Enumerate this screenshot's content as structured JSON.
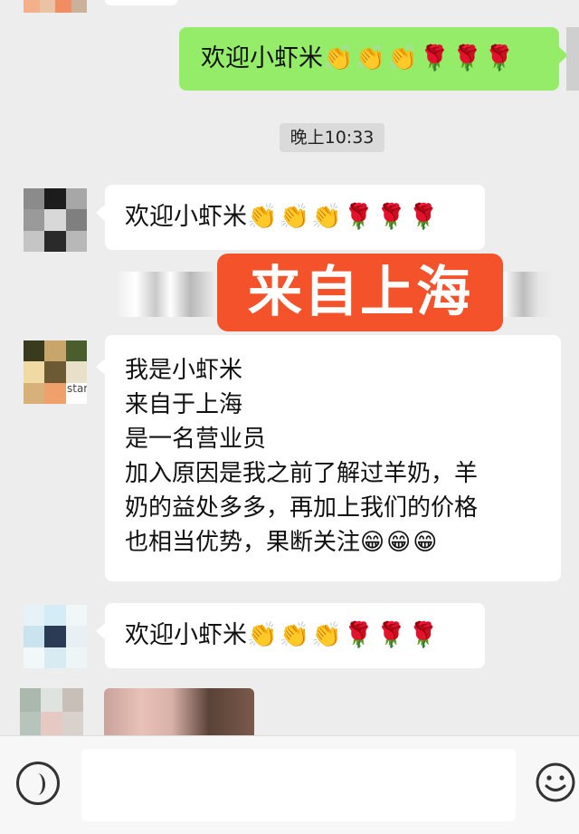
{
  "messages": {
    "sent_welcome": {
      "text": "欢迎小虾米",
      "emoji": "👏👏👏🌹🌹🌹"
    },
    "timestamp": "晚上10:33",
    "welcome_1": {
      "text": "欢迎小虾米",
      "emoji": "👏👏👏🌹🌹🌹"
    },
    "intro": {
      "lines": [
        "我是小虾米",
        "来自于上海",
        "是一名营业员",
        "加入原因是我之前了解过羊奶，羊",
        "奶的益处多多，再加上我们的价格",
        "也相当优势，果断关注"
      ],
      "emoji": "😁😁😁"
    },
    "welcome_2": {
      "text": "欢迎小虾米",
      "emoji": "👏👏👏🌹🌹🌹"
    }
  },
  "overlay_label": "来自上海",
  "avatar_text": "star",
  "colors": {
    "sent_bubble": "#95ec69",
    "received_bubble": "#ffffff",
    "background": "#ededed",
    "overlay": "#f3522b"
  },
  "input_bar": {
    "voice_icon": "voice-icon",
    "emoji_icon": "smiley-icon"
  }
}
